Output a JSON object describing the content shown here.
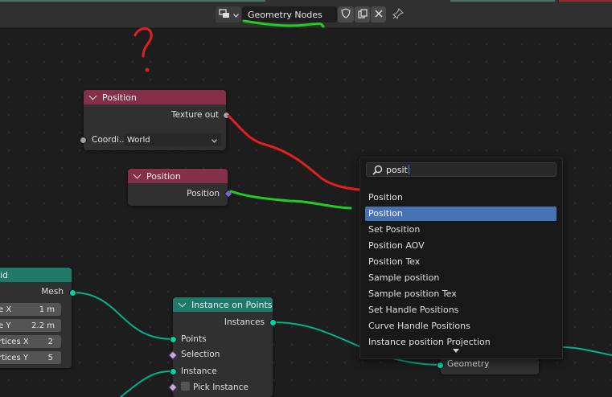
{
  "header": {
    "tree_name": "Geometry Nodes",
    "icons": [
      "node-tree-icon",
      "shield-icon",
      "duplicate-icon",
      "close-icon",
      "pin-icon"
    ]
  },
  "annotation": {
    "question_mark": "?"
  },
  "position_node_a": {
    "title": "Position",
    "output_label": "Texture out",
    "input_label": "Coordi...",
    "select_value": "World"
  },
  "position_node_b": {
    "title": "Position",
    "output_label": "Position"
  },
  "grid_node": {
    "title_fragment": "id",
    "output_label": "Mesh",
    "rows": [
      {
        "label": "e X",
        "value": "1 m"
      },
      {
        "label": "e Y",
        "value": "2.2 m"
      },
      {
        "label": "rtices X",
        "value": "2"
      },
      {
        "label": "rtices Y",
        "value": "5"
      }
    ]
  },
  "instance_node": {
    "title": "Instance on Points",
    "output_label": "Instances",
    "inputs": [
      "Points",
      "Selection",
      "Instance",
      "Pick Instance"
    ]
  },
  "output_node": {
    "input_label": "Geometry"
  },
  "search": {
    "query": "posit",
    "results": [
      "Position",
      "Position",
      "Set Position",
      "Position AOV",
      "Position Tex",
      "Sample position",
      "Sample position Tex",
      "Set Handle Positions",
      "Curve Handle Positions",
      "Instance position Projection"
    ],
    "active_index": 1
  },
  "colors": {
    "input_header": "#84304a",
    "geometry_header": "#1f7a6a",
    "geometry_socket": "#00d6a3",
    "highlight": "#4772b3",
    "annotation_red": "#e02020",
    "annotation_green": "#22cc22"
  }
}
